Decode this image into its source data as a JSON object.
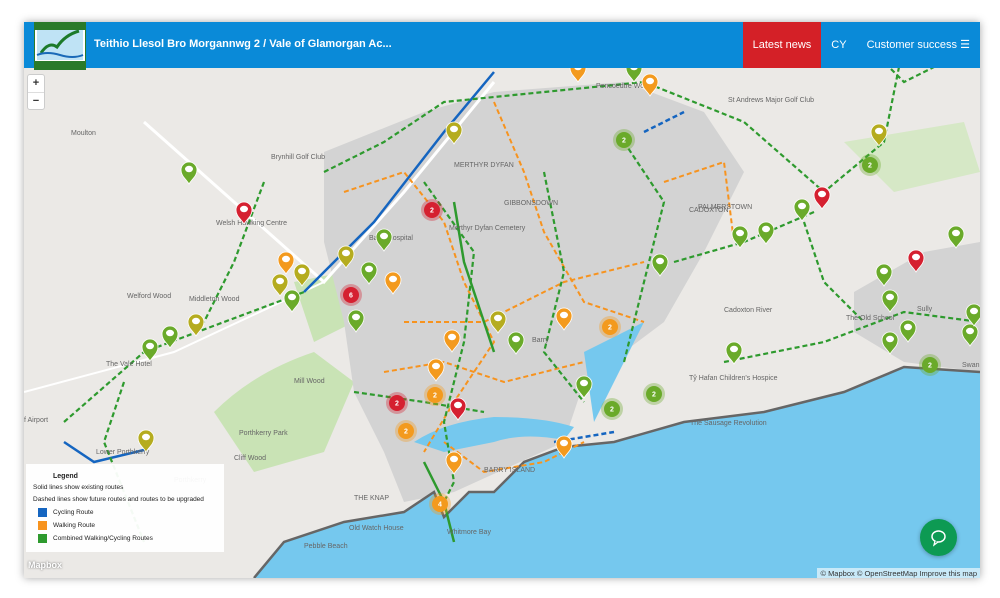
{
  "header": {
    "title": "Teithio Llesol Bro Morgannwg 2 / Vale of Glamorgan Ac...",
    "logo_text_top": "VALE of GLAMORGAN",
    "logo_text_bottom": "BRO MORGANNWG",
    "nav": {
      "latest_news": "Latest news",
      "language": "CY",
      "customer_success": "Customer success"
    },
    "menu_icon": "hamburger-icon"
  },
  "map_controls": {
    "zoom_in": "+",
    "zoom_out": "−"
  },
  "legend": {
    "title": "Legend",
    "solid_note": "Solid lines show existing routes",
    "dashed_note": "Dashed lines show future routes and routes to be upgraded",
    "items": [
      {
        "label": "Cycling Route",
        "color": "#1565c0"
      },
      {
        "label": "Walking Route",
        "color": "#f7931e"
      },
      {
        "label": "Combined Walking/Cycling Routes",
        "color": "#2e9a2e"
      }
    ]
  },
  "colors": {
    "header": "#0a8ad8",
    "news": "#d42027",
    "green_marker": "#6aaa2a",
    "olive_marker": "#b5ac1f",
    "orange_marker": "#f39a1e",
    "red_marker": "#d52030",
    "sea": "#75c8ee",
    "urban": "#d3d3d3"
  },
  "place_labels": [
    "Moulton",
    "Welsh Hawking Centre",
    "Brynhill Golf Club",
    "Welford Wood",
    "Middleton Wood",
    "The Vale Hotel",
    "Mill Wood",
    "Porthkerry Park",
    "Cliff Wood",
    "Porthkerry",
    "Lower Porthkerry",
    "f Airport",
    "MERTHYR DYFAN",
    "GIBBONSDOWN",
    "PALMERSTOWN",
    "CADOXTON",
    "Barry",
    "BARRY ISLAND",
    "THE KNAP",
    "Old Watch House",
    "Pebble Beach",
    "Whitmore Bay",
    "Sully",
    "The Old School",
    "Tŷ Hafan Children's Hospice",
    "The Sausage Revolution",
    "Cadoxton River",
    "St Andrews Major Golf Club",
    "Pencoedtre Wood",
    "Merthyr Dyfan Cemetery",
    "Barry Hospital",
    "Swan"
  ],
  "clusters": [
    "2",
    "2",
    "2",
    "6",
    "2",
    "2",
    "2",
    "2",
    "4",
    "2",
    "2",
    "2"
  ],
  "chat_icon": "speech-bubble-icon",
  "footer": {
    "mapbox": "Mapbox",
    "attribution": "© Mapbox © OpenStreetMap Improve this map"
  }
}
